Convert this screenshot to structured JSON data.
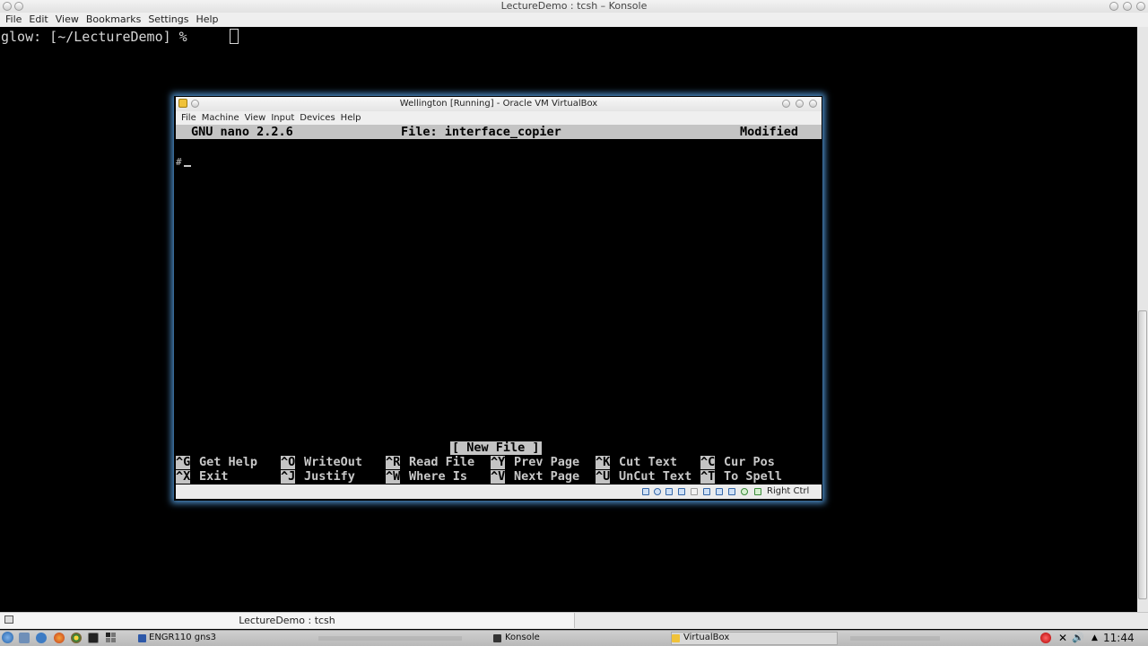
{
  "konsole": {
    "title": "LectureDemo : tcsh – Konsole",
    "menu": [
      "File",
      "Edit",
      "View",
      "Bookmarks",
      "Settings",
      "Help"
    ],
    "prompt": "glow: [~/LectureDemo] % ",
    "tab_label": "LectureDemo : tcsh"
  },
  "vbox": {
    "title": "Wellington [Running] - Oracle VM VirtualBox",
    "menu": [
      "File",
      "Machine",
      "View",
      "Input",
      "Devices",
      "Help"
    ],
    "host_key": "Right Ctrl"
  },
  "nano": {
    "version": "GNU nano 2.2.6",
    "file": "File: interface_copier",
    "state": "Modified",
    "content": "#",
    "status": "[ New File ]",
    "shortcuts_row1": [
      {
        "key": "^G",
        "label": "Get Help"
      },
      {
        "key": "^O",
        "label": "WriteOut"
      },
      {
        "key": "^R",
        "label": "Read File"
      },
      {
        "key": "^Y",
        "label": "Prev Page"
      },
      {
        "key": "^K",
        "label": "Cut Text"
      },
      {
        "key": "^C",
        "label": "Cur Pos"
      }
    ],
    "shortcuts_row2": [
      {
        "key": "^X",
        "label": "Exit"
      },
      {
        "key": "^J",
        "label": "Justify"
      },
      {
        "key": "^W",
        "label": "Where Is"
      },
      {
        "key": "^V",
        "label": "Next Page"
      },
      {
        "key": "^U",
        "label": "UnCut Text"
      },
      {
        "key": "^T",
        "label": "To Spell"
      }
    ]
  },
  "taskbar": {
    "tasks": [
      {
        "label": "ENGR110 gns3",
        "faded": false
      },
      {
        "label": "Konsole",
        "faded": false
      },
      {
        "label": "VirtualBox",
        "faded": false
      }
    ],
    "clock": "11:44"
  }
}
